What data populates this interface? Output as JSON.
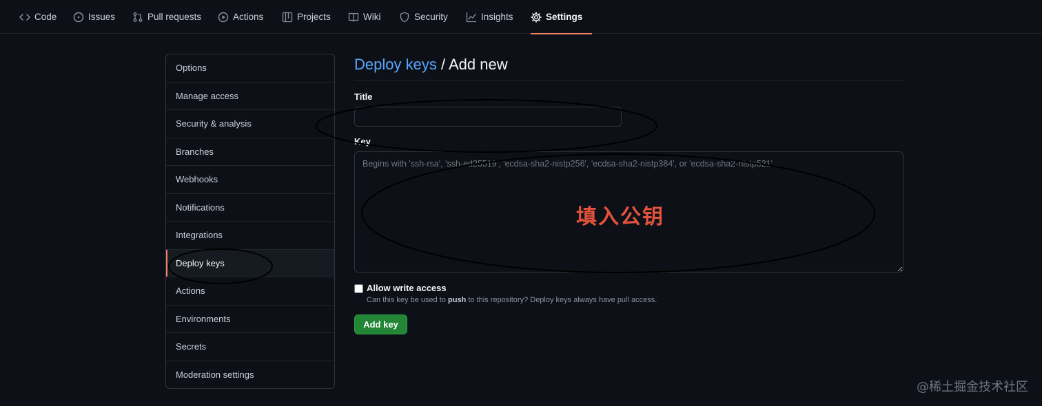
{
  "nav": {
    "tabs": [
      {
        "label": "Code",
        "icon": "code-icon"
      },
      {
        "label": "Issues",
        "icon": "issue-opened-icon"
      },
      {
        "label": "Pull requests",
        "icon": "git-pull-request-icon"
      },
      {
        "label": "Actions",
        "icon": "play-icon"
      },
      {
        "label": "Projects",
        "icon": "table-icon"
      },
      {
        "label": "Wiki",
        "icon": "book-icon"
      },
      {
        "label": "Security",
        "icon": "shield-icon"
      },
      {
        "label": "Insights",
        "icon": "graph-icon"
      },
      {
        "label": "Settings",
        "icon": "gear-icon"
      }
    ],
    "selected": "Settings",
    "underline_color": "#f78166"
  },
  "sidebar": {
    "items": [
      {
        "label": "Options"
      },
      {
        "label": "Manage access"
      },
      {
        "label": "Security & analysis"
      },
      {
        "label": "Branches"
      },
      {
        "label": "Webhooks"
      },
      {
        "label": "Notifications"
      },
      {
        "label": "Integrations"
      },
      {
        "label": "Deploy keys"
      },
      {
        "label": "Actions"
      },
      {
        "label": "Environments"
      },
      {
        "label": "Secrets"
      },
      {
        "label": "Moderation settings"
      }
    ],
    "active": "Deploy keys"
  },
  "main": {
    "heading_link": "Deploy keys",
    "heading_rest": "/ Add new",
    "title_label": "Title",
    "title_value": "",
    "key_label": "Key",
    "key_placeholder": "Begins with 'ssh-rsa', 'ssh-ed25519', 'ecdsa-sha2-nistp256', 'ecdsa-sha2-nistp384', or 'ecdsa-sha2-nistp521'",
    "key_value": "",
    "write_access_label": "Allow write access",
    "write_access_checked": false,
    "write_access_note_pre": "Can this key be used to",
    "write_access_note_bold": "push",
    "write_access_note_post": "to this repository? Deploy keys always have pull access.",
    "submit_label": "Add key"
  },
  "annotation": {
    "text": "填入公钥",
    "color": "#e5533d"
  },
  "watermark": "@稀土掘金技术社区",
  "colors": {
    "background": "#0d1117",
    "link": "#58a6ff",
    "button": "#238636",
    "border": "#30363d"
  }
}
